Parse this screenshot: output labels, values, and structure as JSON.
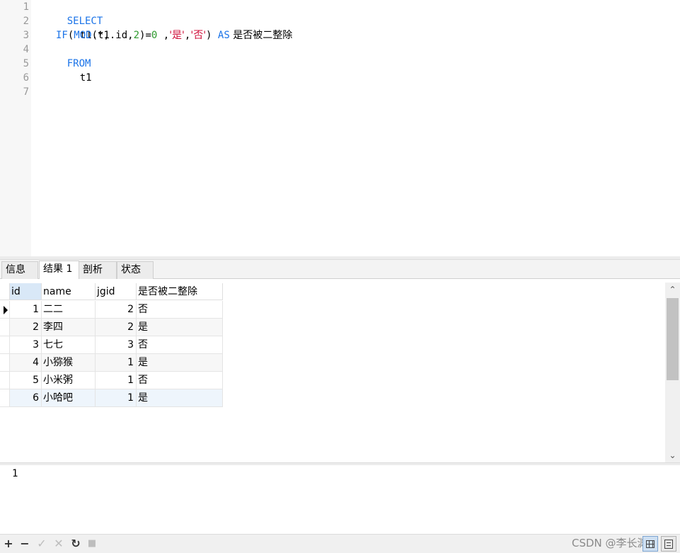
{
  "editor": {
    "line_numbers": [
      "1",
      "2",
      "3",
      "4",
      "5",
      "6",
      "7"
    ],
    "line1": {
      "kw": "SELECT"
    },
    "line2": {
      "text": "t1.*,"
    },
    "line3": {
      "fn_if": "IF",
      "p1": "(",
      "fn_mod": "MOD",
      "p2": "(t1.id,",
      "num2": "2",
      "p3": ")=",
      "num0": "0",
      "p4": " ,",
      "str_yes": "'是'",
      "p5": ",",
      "str_no": "'否'",
      "p6": ") ",
      "kw_as": "AS",
      "alias": " 是否被二整除"
    },
    "line4": {
      "kw": "FROM"
    },
    "line5": {
      "text": "t1"
    }
  },
  "tabs": [
    {
      "label": "信息"
    },
    {
      "label": "结果 1"
    },
    {
      "label": "剖析"
    },
    {
      "label": "状态"
    }
  ],
  "grid": {
    "columns": [
      "id",
      "name",
      "jgid",
      "是否被二整除"
    ],
    "rows": [
      {
        "id": "1",
        "name": "二二",
        "jgid": "2",
        "div": "否"
      },
      {
        "id": "2",
        "name": "李四",
        "jgid": "2",
        "div": "是"
      },
      {
        "id": "3",
        "name": "七七",
        "jgid": "3",
        "div": "否"
      },
      {
        "id": "4",
        "name": "小猕猴",
        "jgid": "1",
        "div": "是"
      },
      {
        "id": "5",
        "name": "小米粥",
        "jgid": "1",
        "div": "否"
      },
      {
        "id": "6",
        "name": "小哈吧",
        "jgid": "1",
        "div": "是"
      }
    ]
  },
  "lower_panel": {
    "value": "1"
  },
  "toolbar": {
    "add": "+",
    "remove": "−",
    "apply": "✓",
    "discard": "✕",
    "refresh": "↻",
    "stop": "■",
    "watermark": "CSDN @李长渊哦"
  },
  "icons": {
    "row_indicator": "arrow-right-icon",
    "scroll_up": "chevron-up-icon",
    "scroll_down": "chevron-down-icon",
    "scroll_up_glyph": "⌃",
    "scroll_down_glyph": "⌄"
  },
  "colors": {
    "keyword": "#1a73e8",
    "number": "#2e9a2e",
    "string": "#d0103a",
    "selected_header": "#d9e8f7"
  }
}
